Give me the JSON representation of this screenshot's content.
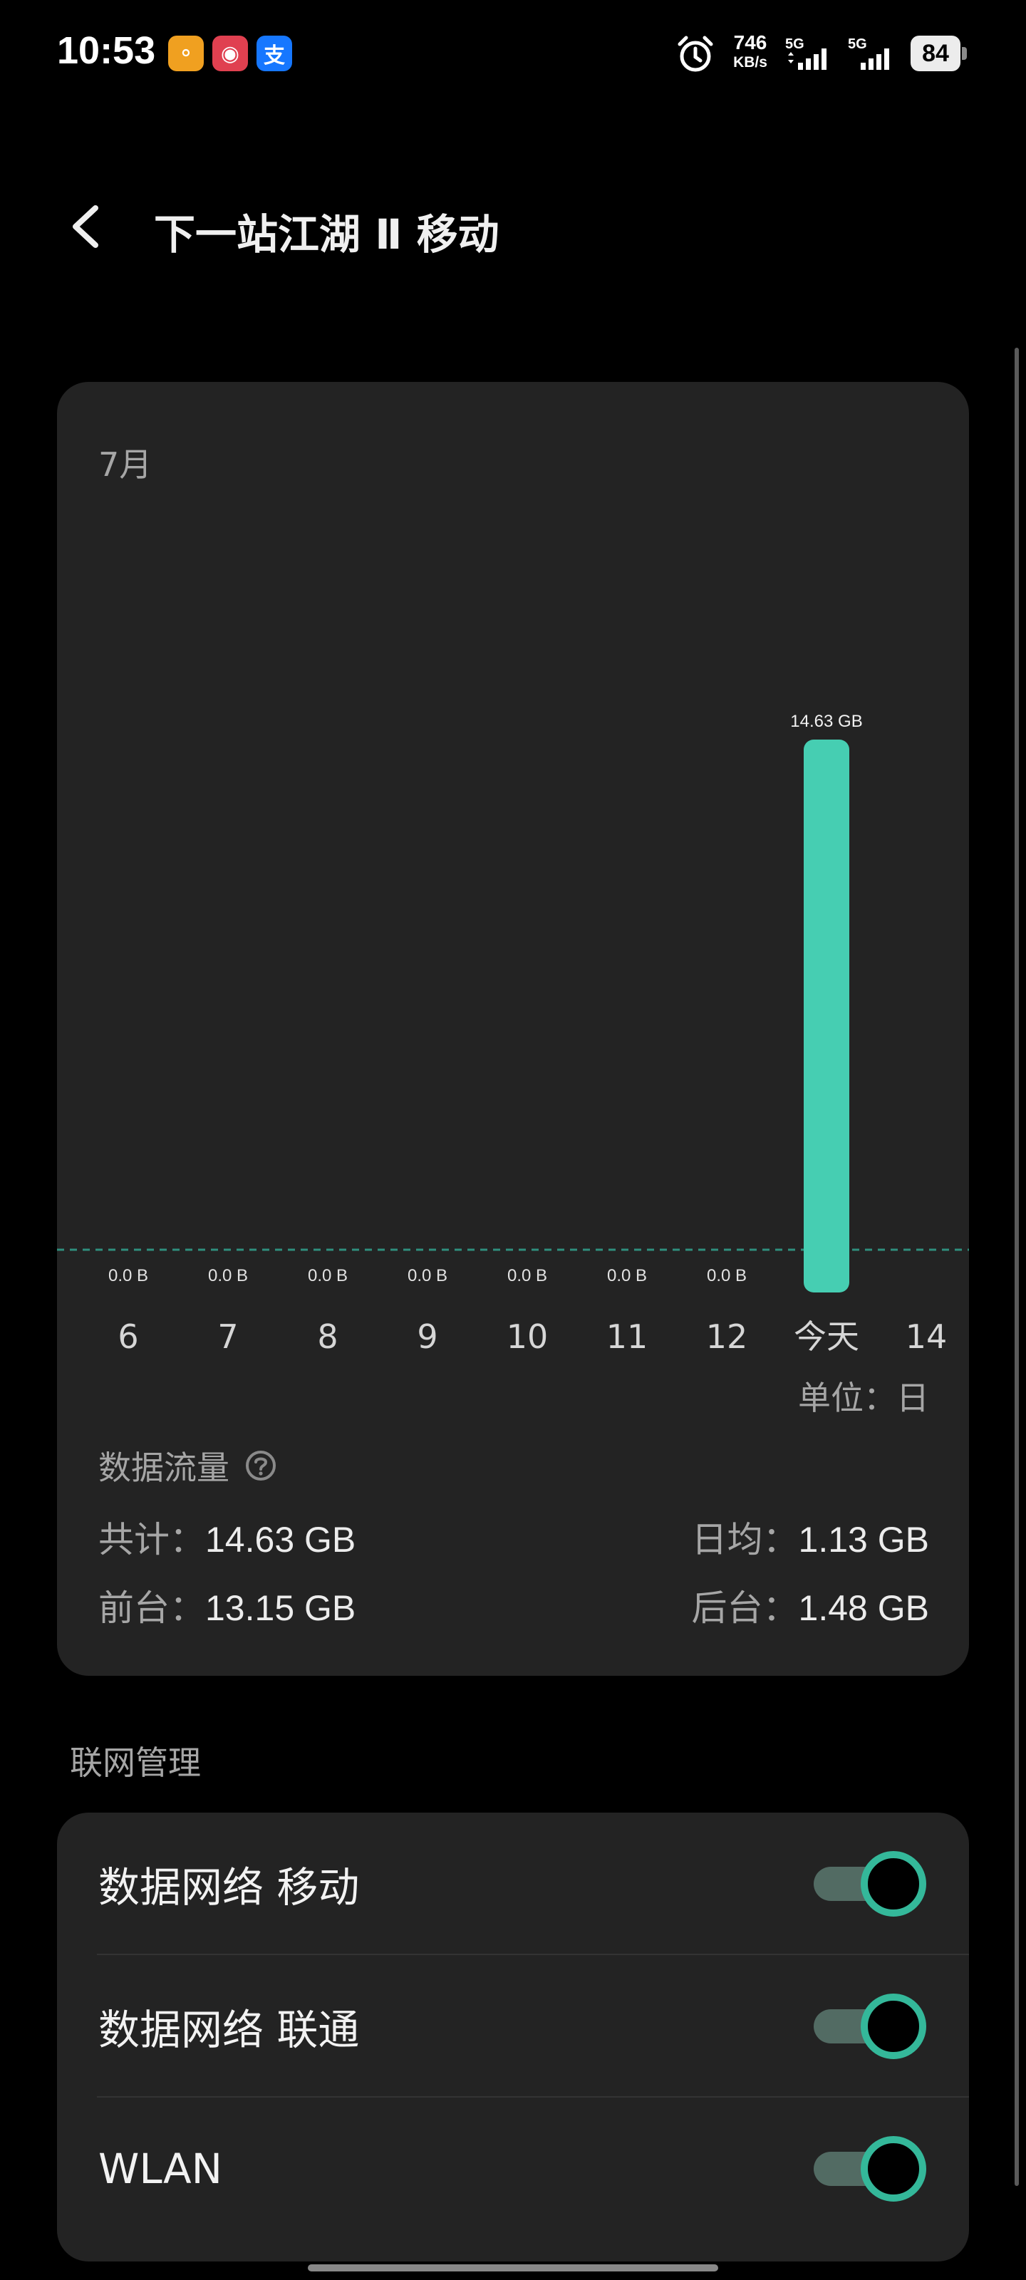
{
  "status_bar": {
    "time": "10:53",
    "app_icons": [
      {
        "name": "game-app-icon",
        "glyph": "⚬",
        "color": "#f0a020"
      },
      {
        "name": "shopping-app-icon",
        "glyph": "◉",
        "color": "#e04050"
      },
      {
        "name": "alipay-icon",
        "glyph": "支",
        "color": "#1677ff"
      }
    ],
    "net_speed_value": "746",
    "net_speed_unit": "KB/s",
    "signal_1_label": "5G",
    "signal_2_label": "5G",
    "battery_level": "84"
  },
  "header": {
    "title": "下一站江湖 Ⅱ  移动"
  },
  "usage_card": {
    "month": "7月",
    "unit_prefix": "单位：",
    "unit_value": "日",
    "section_title": "数据流量",
    "total_label": "共计：",
    "total_value": "14.63 GB",
    "avg_label": "日均：",
    "avg_value": "1.13 GB",
    "fg_label": "前台：",
    "fg_value": "13.15 GB",
    "bg_label": "后台：",
    "bg_value": "1.48 GB"
  },
  "chart_data": {
    "type": "bar",
    "categories": [
      "6",
      "7",
      "8",
      "9",
      "10",
      "11",
      "12",
      "今天",
      "14"
    ],
    "values": [
      0,
      0,
      0,
      0,
      0,
      0,
      0,
      14.63,
      null
    ],
    "value_labels": [
      "0.0 B",
      "0.0 B",
      "0.0 B",
      "0.0 B",
      "0.0 B",
      "0.0 B",
      "0.0 B",
      "14.63 GB",
      ""
    ],
    "unit": "GB",
    "ylim": [
      0,
      14.63
    ],
    "bar_color": "#46ceb2",
    "baseline": "dashed",
    "baseline_color": "#2f8f7e"
  },
  "network": {
    "group_title": "联网管理",
    "rows": [
      {
        "label": "数据网络 移动",
        "enabled": true
      },
      {
        "label": "数据网络 联通",
        "enabled": true
      },
      {
        "label": "WLAN",
        "enabled": true
      }
    ]
  }
}
